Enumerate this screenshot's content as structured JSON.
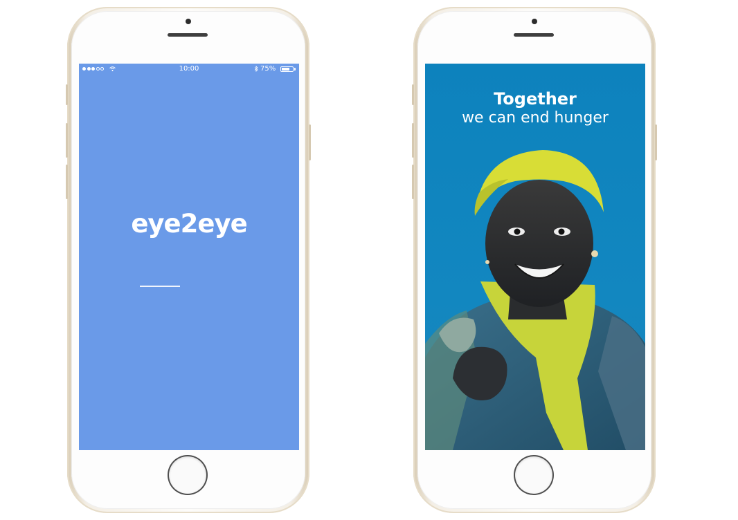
{
  "left_phone": {
    "status_bar": {
      "time": "10:00",
      "battery_percent": "75%",
      "battery_level": 0.75,
      "signal_bars": 5,
      "signal_filled": 3
    },
    "logo": "eye2eye",
    "colors": {
      "screen": "#6a9ae8"
    }
  },
  "right_phone": {
    "headline": "Together",
    "subline": "we can end hunger",
    "colors": {
      "screen": "#0d82bd",
      "headscarf": "#d8dd36",
      "skin": "#2a2a2a"
    }
  }
}
